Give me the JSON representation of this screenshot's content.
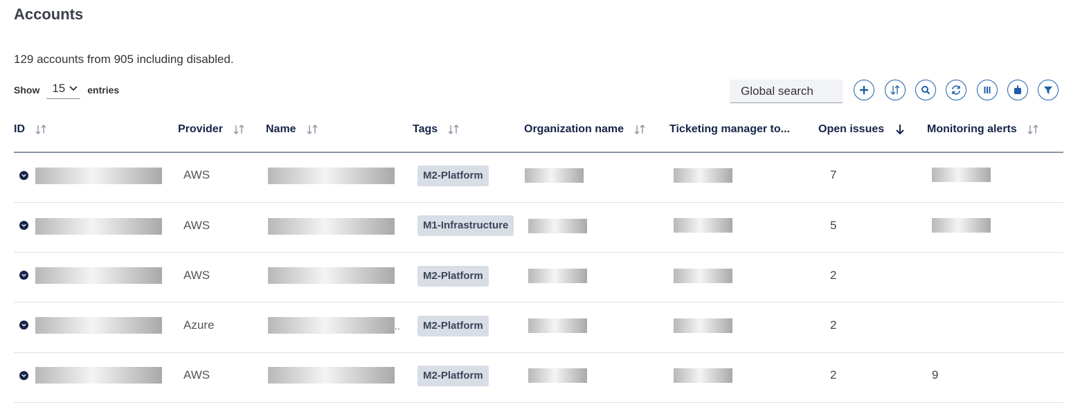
{
  "page": {
    "title": "Accounts",
    "summary": "129 accounts from 905 including disabled."
  },
  "controls": {
    "show_label": "Show",
    "entries_value": "15",
    "entries_label": "entries",
    "search_placeholder": "Global search",
    "toolbar_icons": [
      "plus-icon",
      "sort-icon",
      "search-icon",
      "refresh-icon",
      "columns-icon",
      "export-icon",
      "filter-icon"
    ],
    "accent_color": "#1e5ea8"
  },
  "table": {
    "columns": [
      {
        "label": "ID",
        "sort": "none"
      },
      {
        "label": "Provider",
        "sort": "none"
      },
      {
        "label": "Name",
        "sort": "none"
      },
      {
        "label": "Tags",
        "sort": "none"
      },
      {
        "label": "Organization name",
        "sort": "none"
      },
      {
        "label": "Ticketing manager to...",
        "sort": "none"
      },
      {
        "label": "Open issues",
        "sort": "descending"
      },
      {
        "label": "Monitoring alerts",
        "sort": "none"
      }
    ],
    "rows": [
      {
        "provider": "AWS",
        "tag": "M2-Platform",
        "open_issues": "7",
        "monitoring_alerts": ""
      },
      {
        "provider": "AWS",
        "tag": "M1-Infrastructure",
        "open_issues": "5",
        "monitoring_alerts": ""
      },
      {
        "provider": "AWS",
        "tag": "M2-Platform",
        "open_issues": "2",
        "monitoring_alerts": ""
      },
      {
        "provider": "Azure",
        "tag": "M2-Platform",
        "open_issues": "2",
        "monitoring_alerts": ""
      },
      {
        "provider": "AWS",
        "tag": "M2-Platform",
        "open_issues": "2",
        "monitoring_alerts": "9"
      }
    ],
    "name_overflow_marker": ".."
  }
}
